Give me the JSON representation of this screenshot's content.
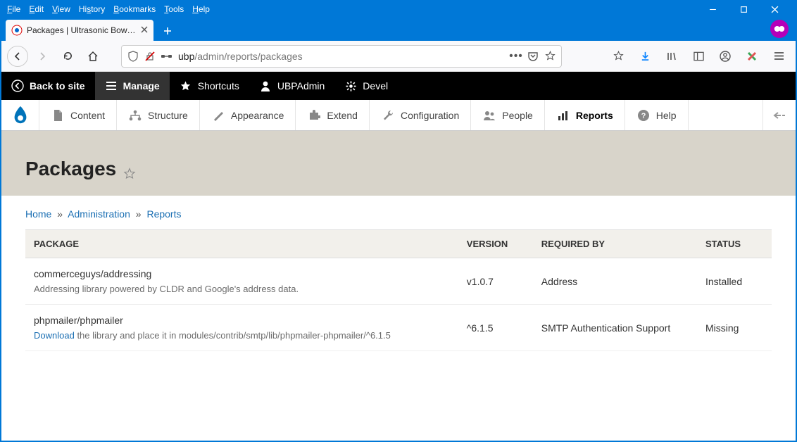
{
  "os_menu": {
    "items": [
      "File",
      "Edit",
      "View",
      "History",
      "Bookmarks",
      "Tools",
      "Help"
    ]
  },
  "browser": {
    "tab_title": "Packages | Ultrasonic Bowling P",
    "url_host": "ubp",
    "url_path": "/admin/reports/packages"
  },
  "drupal_toolbar": {
    "back_to_site": "Back to site",
    "manage": "Manage",
    "shortcuts": "Shortcuts",
    "user": "UBPAdmin",
    "devel": "Devel"
  },
  "admin_menu": {
    "items": [
      {
        "label": "Content"
      },
      {
        "label": "Structure"
      },
      {
        "label": "Appearance"
      },
      {
        "label": "Extend"
      },
      {
        "label": "Configuration"
      },
      {
        "label": "People"
      },
      {
        "label": "Reports",
        "active": true
      },
      {
        "label": "Help"
      }
    ]
  },
  "page": {
    "title": "Packages",
    "breadcrumb": {
      "home": "Home",
      "administration": "Administration",
      "reports": "Reports"
    }
  },
  "table": {
    "headers": {
      "package": "PACKAGE",
      "version": "VERSION",
      "required_by": "REQUIRED BY",
      "status": "STATUS"
    },
    "rows": [
      {
        "name": "commerceguys/addressing",
        "desc_prefix": "",
        "desc_link": "",
        "desc_suffix": "Addressing library powered by CLDR and Google's address data.",
        "version": "v1.0.7",
        "required_by": "Address",
        "status": "Installed"
      },
      {
        "name": "phpmailer/phpmailer",
        "desc_prefix": "",
        "desc_link": "Download",
        "desc_suffix": " the library and place it in modules/contrib/smtp/lib/phpmailer-phpmailer/^6.1.5",
        "version": "^6.1.5",
        "required_by": "SMTP Authentication Support",
        "status": "Missing"
      }
    ]
  }
}
